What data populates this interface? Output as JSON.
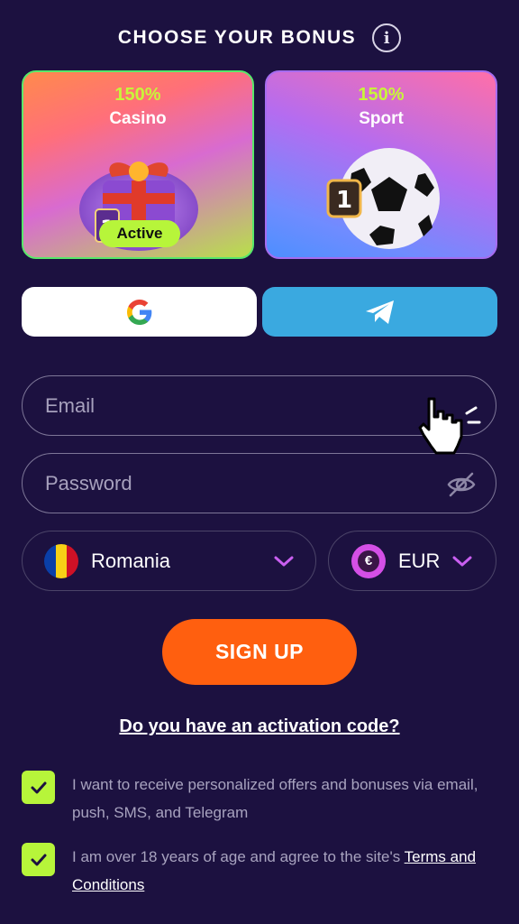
{
  "header": {
    "title": "CHOOSE YOUR BONUS",
    "info_icon": "info-circle-icon"
  },
  "bonuses": [
    {
      "percent": "150%",
      "name": "Casino",
      "badge": "Active",
      "image_icon": "gift-box-icon",
      "active": true
    },
    {
      "percent": "150%",
      "name": "Sport",
      "image_icon": "soccer-ball-icon",
      "active": false
    }
  ],
  "social": {
    "google_icon": "google-logo-icon",
    "telegram_icon": "telegram-logo-icon"
  },
  "form": {
    "email_placeholder": "Email",
    "password_placeholder": "Password",
    "country": "Romania",
    "currency": "EUR",
    "currency_symbol": "€",
    "signup_label": "SIGN UP",
    "activation_link": "Do you have an activation code?"
  },
  "consents": [
    {
      "text": "I want to receive personalized offers and bonuses via email, push, SMS, and Telegram",
      "checked": true
    },
    {
      "text": "I am over 18 years of age and agree to the site's ",
      "link_text": "Terms and Conditions",
      "checked": true
    }
  ],
  "colors": {
    "background": "#1c1140",
    "accent_green": "#b7f53a",
    "signup_orange": "#ff5f0f",
    "telegram_blue": "#3aa9e0",
    "chevron_purple": "#c95ff0"
  }
}
